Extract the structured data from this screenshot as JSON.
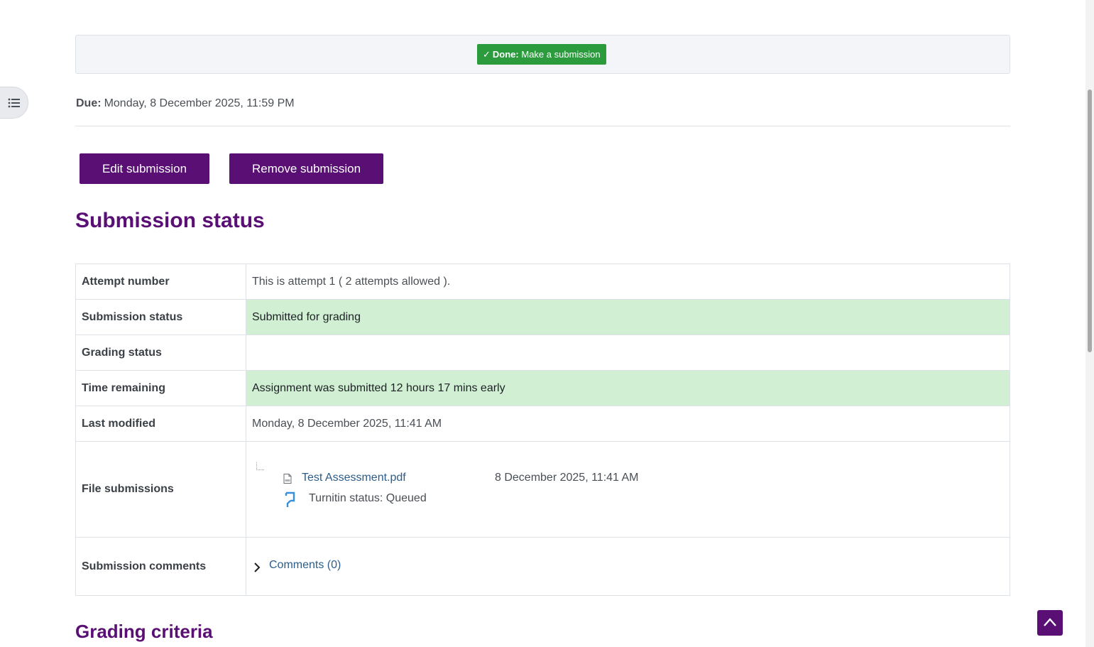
{
  "completion": {
    "done_label": "Done:",
    "done_text": "Make a submission",
    "color": "#2b9b3e"
  },
  "due": {
    "label": "Due:",
    "value": "Monday, 8 December 2025, 11:59 PM"
  },
  "actions": {
    "edit_label": "Edit submission",
    "remove_label": "Remove submission",
    "color": "#5a0f75"
  },
  "submission_status": {
    "heading": "Submission status",
    "rows": {
      "attempt": {
        "label": "Attempt number",
        "value": "This is attempt 1 ( 2 attempts allowed )."
      },
      "status": {
        "label": "Submission status",
        "value": "Submitted for grading"
      },
      "grading": {
        "label": "Grading status",
        "value": ""
      },
      "time": {
        "label": "Time remaining",
        "value": "Assignment was submitted 12 hours 17 mins early"
      },
      "modified": {
        "label": "Last modified",
        "value": "Monday, 8 December 2025, 11:41 AM"
      },
      "files": {
        "label": "File submissions",
        "file_name": "Test Assessment.pdf",
        "file_date": "8 December 2025, 11:41 AM",
        "turnitin_status": "Turnitin status: Queued",
        "file_icon": "pdf-icon",
        "turnitin_icon": "turnitin-icon"
      },
      "comments": {
        "label": "Submission comments",
        "link": "Comments (0)"
      }
    },
    "success_bg": "#d1f0d3"
  },
  "grading_criteria": {
    "heading": "Grading criteria"
  },
  "icons": {
    "drawer": "list-icon",
    "back_to_top": "chevron-up-icon"
  }
}
